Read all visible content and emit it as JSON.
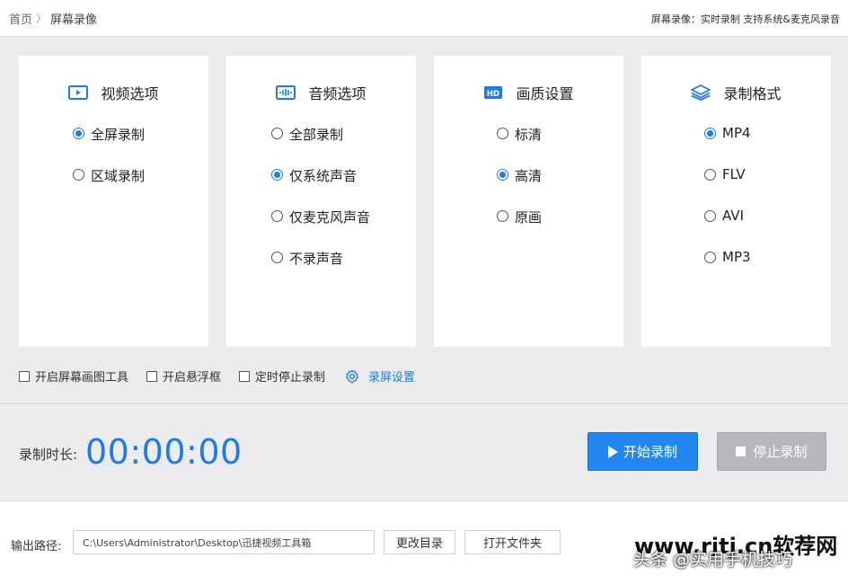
{
  "breadcrumb": {
    "home": "首页",
    "separator": "〉",
    "current": "屏幕录像"
  },
  "header": {
    "description": "屏幕录像：实时录制 支持系统&麦克风录音"
  },
  "accent_color": "#1f7be8",
  "cards": [
    {
      "title": "视频选项",
      "icon": "video-icon",
      "options": [
        {
          "label": "全屏录制",
          "selected": true
        },
        {
          "label": "区域录制",
          "selected": false
        }
      ]
    },
    {
      "title": "音频选项",
      "icon": "audio-wave-icon",
      "options": [
        {
          "label": "全部录制",
          "selected": false
        },
        {
          "label": "仅系统声音",
          "selected": true
        },
        {
          "label": "仅麦克风声音",
          "selected": false
        },
        {
          "label": "不录声音",
          "selected": false
        }
      ]
    },
    {
      "title": "画质设置",
      "icon": "hd-icon",
      "options": [
        {
          "label": "标清",
          "selected": false
        },
        {
          "label": "高清",
          "selected": true
        },
        {
          "label": "原画",
          "selected": false
        }
      ]
    },
    {
      "title": "录制格式",
      "icon": "layers-icon",
      "options": [
        {
          "label": "MP4",
          "selected": true
        },
        {
          "label": "FLV",
          "selected": false
        },
        {
          "label": "AVI",
          "selected": false
        },
        {
          "label": "MP3",
          "selected": false
        }
      ]
    }
  ],
  "extras": {
    "draw_tool": "开启屏幕画图工具",
    "float_window": "开启悬浮框",
    "timed_stop": "定时停止录制",
    "settings": "录屏设置"
  },
  "recording": {
    "duration_label": "录制时长:",
    "duration": "00:00:00",
    "start_label": "开始录制",
    "stop_label": "停止录制"
  },
  "output": {
    "label": "输出路径:",
    "path": "C:\\Users\\Administrator\\Desktop\\迅捷视频工具箱",
    "change_dir": "更改目录",
    "open_folder": "打开文件夹"
  },
  "watermark": {
    "site": "www.rjtj.cn软荐网",
    "author": "头条 @实用手机技巧"
  }
}
